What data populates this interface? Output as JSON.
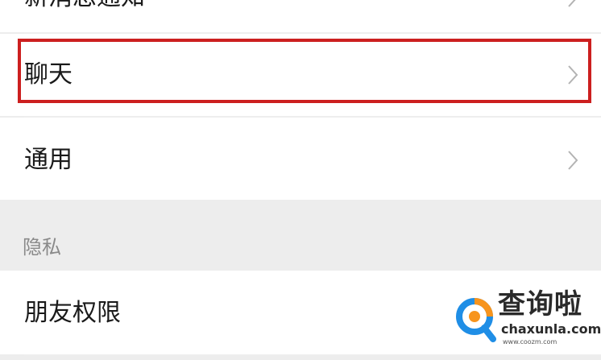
{
  "settings": {
    "top_row": {
      "label": "新消息通知"
    },
    "rows": [
      {
        "label": "聊天"
      },
      {
        "label": "通用"
      }
    ],
    "privacy_section": {
      "header": "隐私",
      "rows": [
        {
          "label": "朋友权限"
        }
      ]
    }
  },
  "watermark": {
    "title": "查询啦",
    "domain": "chaxunla.com",
    "sub": "www.coozm.com"
  },
  "colors": {
    "highlight_border": "#cc1f1f",
    "background": "#ededed",
    "row_background": "#ffffff",
    "logo_blue": "#1f8ee6",
    "logo_orange": "#f7941d"
  },
  "icons": {
    "row_arrow": "chevron-right-icon"
  }
}
